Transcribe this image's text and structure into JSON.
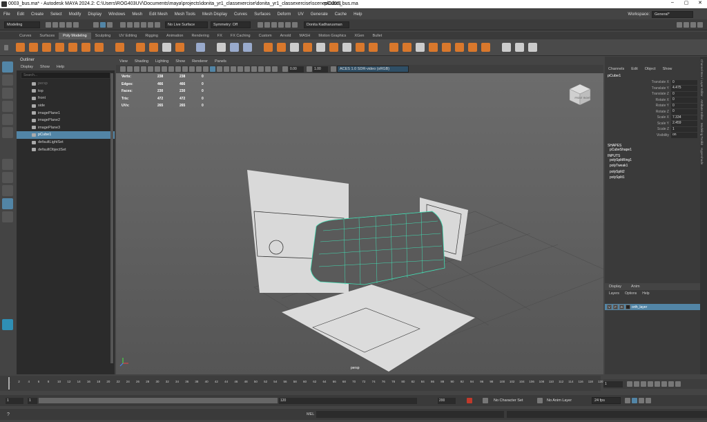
{
  "window": {
    "title": "0003_bus.ma* - Autodesk MAYA 2024.2: C:\\Users\\ROG403UV\\Documents\\maya\\projects\\donita_yr1_classexercise\\donita_yr1_classexercise\\scenes\\0003_bus.ma",
    "selection": "pCube1"
  },
  "menubar": [
    "File",
    "Edit",
    "Create",
    "Select",
    "Modify",
    "Display",
    "Windows",
    "Mesh",
    "Edit Mesh",
    "Mesh Tools",
    "Mesh Display",
    "Curves",
    "Surfaces",
    "Deform",
    "UV",
    "Generate",
    "Cache",
    "Help"
  ],
  "workspace": {
    "label": "Workspace:",
    "value": "General*"
  },
  "statusline": {
    "menuset": "Modeling",
    "live_surface": "No Live Surface",
    "symmetry": "Symmetry: Off",
    "user": "Donita Kadharusman"
  },
  "shelf_tabs": [
    "Curves",
    "Surfaces",
    "Poly Modeling",
    "Sculpting",
    "UV Editing",
    "Rigging",
    "Animation",
    "Rendering",
    "FX",
    "FX Caching",
    "Custom",
    "Arnold",
    "MASH",
    "Motion Graphics",
    "XGen",
    "Bullet"
  ],
  "shelf_active": "Poly Modeling",
  "outliner": {
    "title": "Outliner",
    "menu": [
      "Display",
      "Show",
      "Help"
    ],
    "search_placeholder": "Search...",
    "items": [
      {
        "label": "persp",
        "dim": true
      },
      {
        "label": "top"
      },
      {
        "label": "front"
      },
      {
        "label": "side"
      },
      {
        "label": "imagePlane1"
      },
      {
        "label": "imagePlane2"
      },
      {
        "label": "imagePlane3"
      },
      {
        "label": "pCube1",
        "selected": true
      },
      {
        "label": "defaultLightSet"
      },
      {
        "label": "defaultObjectSet"
      }
    ]
  },
  "panel_menu": [
    "View",
    "Shading",
    "Lighting",
    "Show",
    "Renderer",
    "Panels"
  ],
  "panel_tools": {
    "exposure": "0.00",
    "gamma": "1.00",
    "color_space": "ACES 1.0 SDR-video (sRGB)"
  },
  "hud": [
    {
      "label": "Verts:",
      "a": "238",
      "b": "238",
      "c": "0"
    },
    {
      "label": "Edges:",
      "a": "466",
      "b": "466",
      "c": "0"
    },
    {
      "label": "Faces:",
      "a": "230",
      "b": "230",
      "c": "0"
    },
    {
      "label": "Tris:",
      "a": "472",
      "b": "472",
      "c": "0"
    },
    {
      "label": "UVs:",
      "a": "265",
      "b": "265",
      "c": "0"
    }
  ],
  "viewcube": {
    "front": "FRONT",
    "right": "RIGHT"
  },
  "camera_label": "persp",
  "channel_box": {
    "tabs": [
      "Channels",
      "Edit",
      "Object",
      "Show"
    ],
    "object": "pCube1",
    "channels": [
      {
        "name": "Translate X",
        "value": "0"
      },
      {
        "name": "Translate Y",
        "value": "4.475"
      },
      {
        "name": "Translate Z",
        "value": "0"
      },
      {
        "name": "Rotate X",
        "value": "0"
      },
      {
        "name": "Rotate Y",
        "value": "0"
      },
      {
        "name": "Rotate Z",
        "value": "0"
      },
      {
        "name": "Scale X",
        "value": "7.334"
      },
      {
        "name": "Scale Y",
        "value": "2.459"
      },
      {
        "name": "Scale Z",
        "value": "1"
      },
      {
        "name": "Visibility",
        "value": "on"
      }
    ],
    "shapes_label": "SHAPES",
    "shape": "pCubeShape1",
    "inputs_label": "INPUTS",
    "inputs": [
      "polySplitRing1",
      "polyTweak1",
      "polySplit2",
      "polySplit1"
    ]
  },
  "side_tabs": [
    "Channel Box / Layer Editor",
    "Attribute Editor",
    "Modeling Toolkit",
    "Hypershade"
  ],
  "layers": {
    "tabs": [
      "Display",
      "Anim"
    ],
    "menu": [
      "Layers",
      "Options",
      "Help"
    ],
    "row": {
      "v": "V",
      "p": "P",
      "r": "R",
      "name": "orth_layer"
    }
  },
  "timeline": {
    "ticks": [
      "1",
      "2",
      "4",
      "6",
      "8",
      "10",
      "12",
      "14",
      "16",
      "18",
      "20",
      "22",
      "24",
      "26",
      "28",
      "30",
      "32",
      "34",
      "36",
      "38",
      "40",
      "42",
      "44",
      "46",
      "48",
      "50",
      "52",
      "54",
      "56",
      "58",
      "60",
      "62",
      "64",
      "66",
      "68",
      "70",
      "72",
      "74",
      "76",
      "78",
      "80",
      "82",
      "84",
      "86",
      "88",
      "90",
      "92",
      "94",
      "96",
      "98",
      "100",
      "102",
      "104",
      "106",
      "108",
      "110",
      "112",
      "114",
      "116",
      "118",
      "120"
    ],
    "current_frame": "1"
  },
  "range": {
    "start": "1",
    "inner_start": "1",
    "inner_end": "120",
    "end": "200",
    "character_set": "No Character Set",
    "anim_layer": "No Anim Layer",
    "fps": "24 fps"
  },
  "cmd": {
    "label": "MEL"
  }
}
